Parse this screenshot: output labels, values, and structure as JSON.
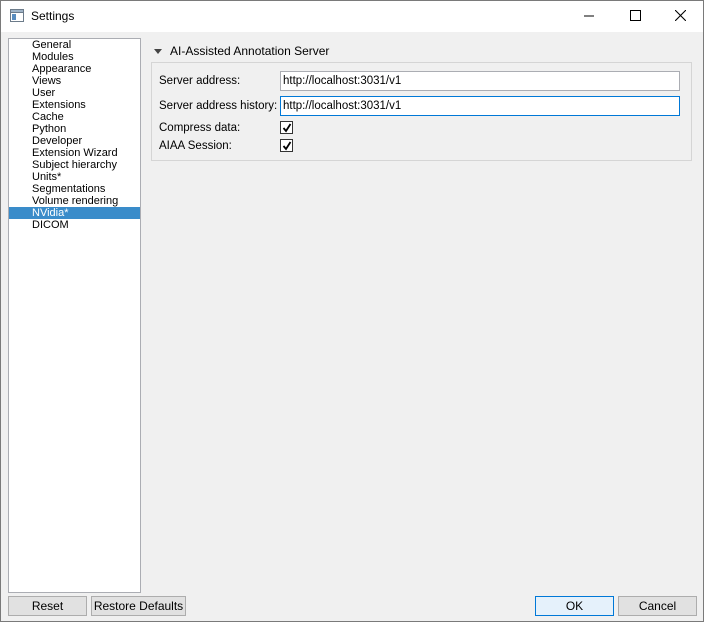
{
  "window": {
    "title": "Settings"
  },
  "sidebar": {
    "items": [
      {
        "label": "General"
      },
      {
        "label": "Modules"
      },
      {
        "label": "Appearance"
      },
      {
        "label": "Views"
      },
      {
        "label": "User"
      },
      {
        "label": "Extensions"
      },
      {
        "label": "Cache"
      },
      {
        "label": "Python"
      },
      {
        "label": "Developer"
      },
      {
        "label": "Extension Wizard"
      },
      {
        "label": "Subject hierarchy"
      },
      {
        "label": "Units*"
      },
      {
        "label": "Segmentations"
      },
      {
        "label": "Volume rendering"
      },
      {
        "label": "NVidia*",
        "selected": true
      },
      {
        "label": "DICOM"
      }
    ]
  },
  "section": {
    "title": "AI-Assisted Annotation Server",
    "server_address_label": "Server address:",
    "server_address_value": "http://localhost:3031/v1",
    "server_history_label": "Server address history:",
    "server_history_value": "http://localhost:3031/v1",
    "compress_label": "Compress data:",
    "compress_checked": true,
    "session_label": "AIAA Session:",
    "session_checked": true
  },
  "buttons": {
    "reset": "Reset",
    "restore_defaults": "Restore Defaults",
    "ok": "OK",
    "cancel": "Cancel"
  },
  "colors": {
    "selection": "#3a8cca",
    "focus_border": "#0078d7"
  },
  "icons": {
    "app": "settings-app-icon",
    "minimize": "minimize-icon",
    "maximize": "maximize-icon",
    "close": "close-icon",
    "collapse": "collapse-arrow-icon",
    "check": "checkmark-icon"
  }
}
